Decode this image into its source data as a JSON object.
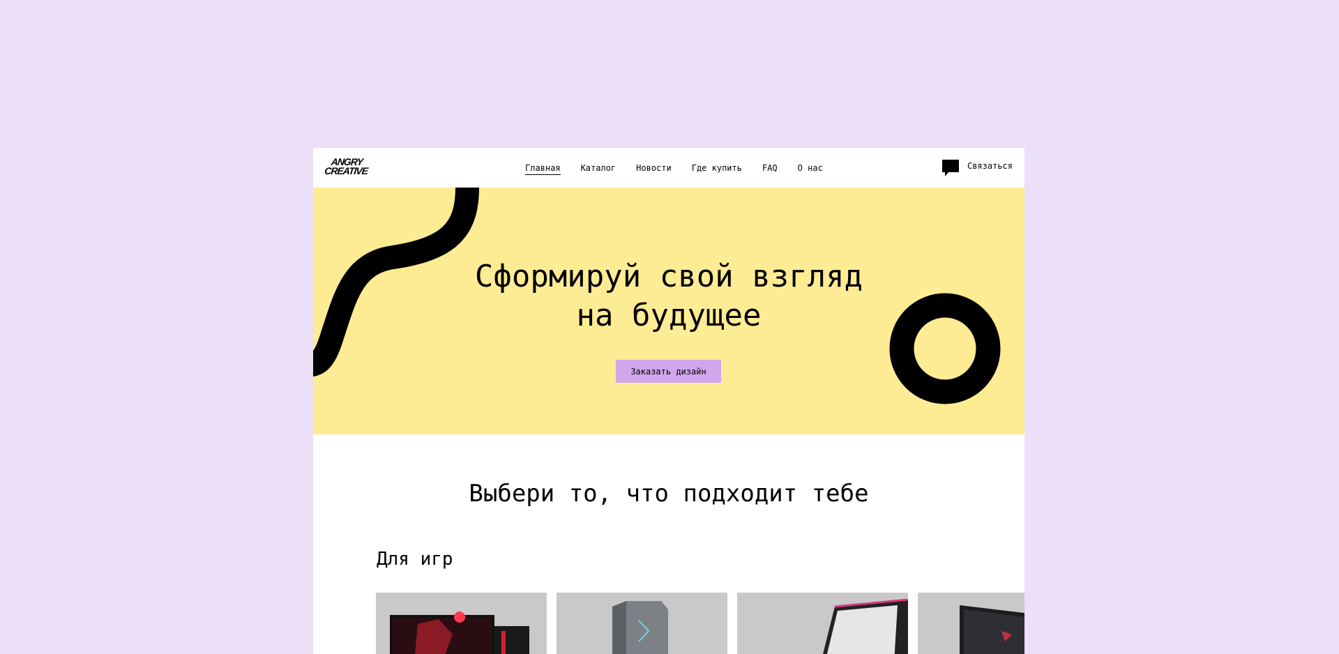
{
  "header": {
    "logo_line1": "ANGRY",
    "logo_line2": "CREATIVE",
    "nav": [
      {
        "label": "Главная",
        "active": true
      },
      {
        "label": "Каталог"
      },
      {
        "label": "Новости"
      },
      {
        "label": "Где купить"
      },
      {
        "label": "FAQ"
      },
      {
        "label": "О нас"
      }
    ],
    "contact_label": "Связаться",
    "contact_icon": "chat-bubble-icon"
  },
  "hero": {
    "title_line1": "Сформируй свой взгляд",
    "title_line2": "на будущее",
    "cta_label": "Заказать дизайн",
    "background": "#feec94",
    "cta_color": "#d1a6ec"
  },
  "catalog": {
    "heading": "Выбери то, что подходит тебе",
    "category": "Для игр",
    "cards": [
      {
        "name": "gaming-setup-image"
      },
      {
        "name": "desktop-tower-image"
      },
      {
        "name": "laptop-image"
      },
      {
        "name": "laptop-image-2"
      }
    ]
  },
  "colors": {
    "page_bg": "#ecdff7",
    "accent": "#d1a6ec"
  }
}
